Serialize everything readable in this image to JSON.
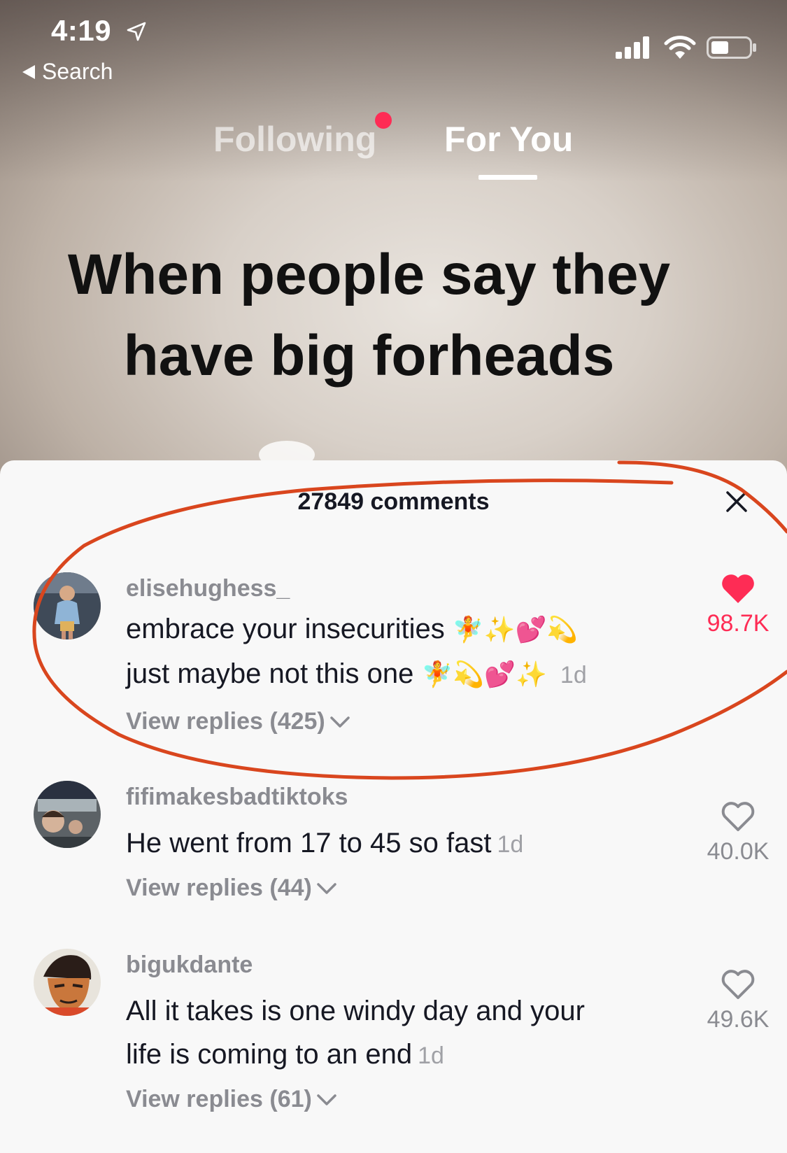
{
  "status_bar": {
    "time": "4:19",
    "back_label": "Search"
  },
  "feed_tabs": {
    "following": "Following",
    "for_you": "For You"
  },
  "video": {
    "caption_line1": "When people say they",
    "caption_line2": "have big forheads"
  },
  "comments_sheet": {
    "title": "27849 comments",
    "comments": [
      {
        "username": "elisehughess_",
        "line1": "embrace your insecurities",
        "line1_emoji": "🧚✨💕💫",
        "line2": "just maybe not this one",
        "line2_emoji": "🧚💫💕✨",
        "time": "1d",
        "replies": "View replies (425)",
        "likes": "98.7K",
        "liked": true
      },
      {
        "username": "fifimakesbadtiktoks",
        "text": "He went from 17 to 45 so fast",
        "time": "1d",
        "replies": "View replies (44)",
        "likes": "40.0K",
        "liked": false
      },
      {
        "username": "bigukdante",
        "line1": "All it takes is one windy day and your",
        "line2": "life is coming to an end",
        "time": "1d",
        "replies": "View replies (61)",
        "likes": "49.6K",
        "liked": false
      }
    ]
  },
  "colors": {
    "like_active": "#fe2c55",
    "annotation": "#d9461e"
  }
}
